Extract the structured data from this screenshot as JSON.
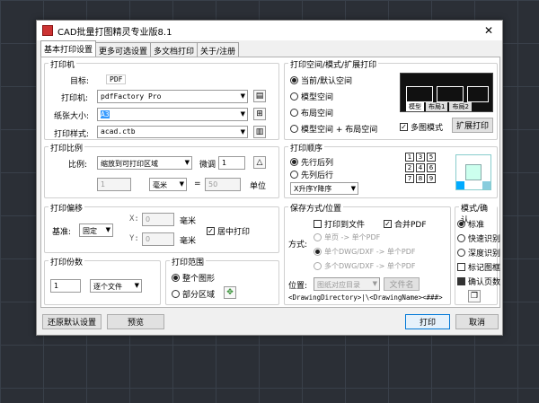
{
  "window": {
    "title": "CAD批量打图精灵专业版8.1",
    "close": "✕"
  },
  "tabs": [
    "基本打印设置",
    "更多可选设置",
    "多文档打印",
    "关于/注册"
  ],
  "printer": {
    "group": "打印机",
    "target_label": "目标:",
    "target_value": "PDF",
    "printer_label": "打印机:",
    "printer_value": "pdfFactory Pro",
    "paper_label": "纸张大小:",
    "paper_value": "A3",
    "style_label": "打印样式:",
    "style_value": "acad.ctb"
  },
  "space": {
    "group": "打印空间/模式/扩展打印",
    "options": [
      "当前/默认空间",
      "模型空间",
      "布局空间",
      "模型空间 + 布局空间"
    ],
    "tabs": [
      "模型",
      "布局1",
      "布局2"
    ],
    "multi_label": "多图模式",
    "ext_button": "扩展打印"
  },
  "scale": {
    "group": "打印比例",
    "ratio_label": "比例:",
    "ratio_value": "缩放到可打印区域",
    "fine_label": "微调",
    "fine_value": "1",
    "num1": "1",
    "unit_value": "毫米",
    "eq": "=",
    "num2": "50",
    "unit_label": "单位"
  },
  "order": {
    "group": "打印顺序",
    "options": [
      "先行后列",
      "先列后行"
    ],
    "sort_value": "X升序Y降序",
    "nums": [
      "1",
      "3",
      "5",
      "2",
      "4",
      "6",
      "7",
      "8",
      "9"
    ]
  },
  "offset": {
    "group": "打印偏移",
    "base_label": "基准:",
    "base_value": "固定",
    "x_label": "X:",
    "x_value": "0",
    "y_label": "Y:",
    "y_value": "0",
    "mm1": "毫米",
    "mm2": "毫米",
    "center_label": "居中打印"
  },
  "save": {
    "group": "保存方式/位置",
    "to_file": "打印到文件",
    "merge_pdf": "合并PDF",
    "mode_label": "方式:",
    "modes": [
      "单页 -> 单个PDF",
      "单个DWG/DXF -> 单个PDF",
      "多个DWG/DXF -> 单个PDF"
    ],
    "loc_label": "位置:",
    "loc_value": "图纸对应目录",
    "filename_btn": "文件名",
    "path": "<DrawingDirectory>|\\<DrawingName><###>"
  },
  "mode": {
    "group": "模式/确认",
    "options": [
      "标准",
      "快速识别",
      "深度识别"
    ],
    "mark_label": "标记图框",
    "confirm_label": "确认页数"
  },
  "copies": {
    "group": "打印份数",
    "value": "1",
    "mode_value": "逐个文件"
  },
  "range": {
    "group": "打印范围",
    "options": [
      "整个图形",
      "部分区域"
    ]
  },
  "footer": {
    "reset": "还原默认设置",
    "preview": "预览",
    "print": "打印",
    "cancel": "取消"
  }
}
